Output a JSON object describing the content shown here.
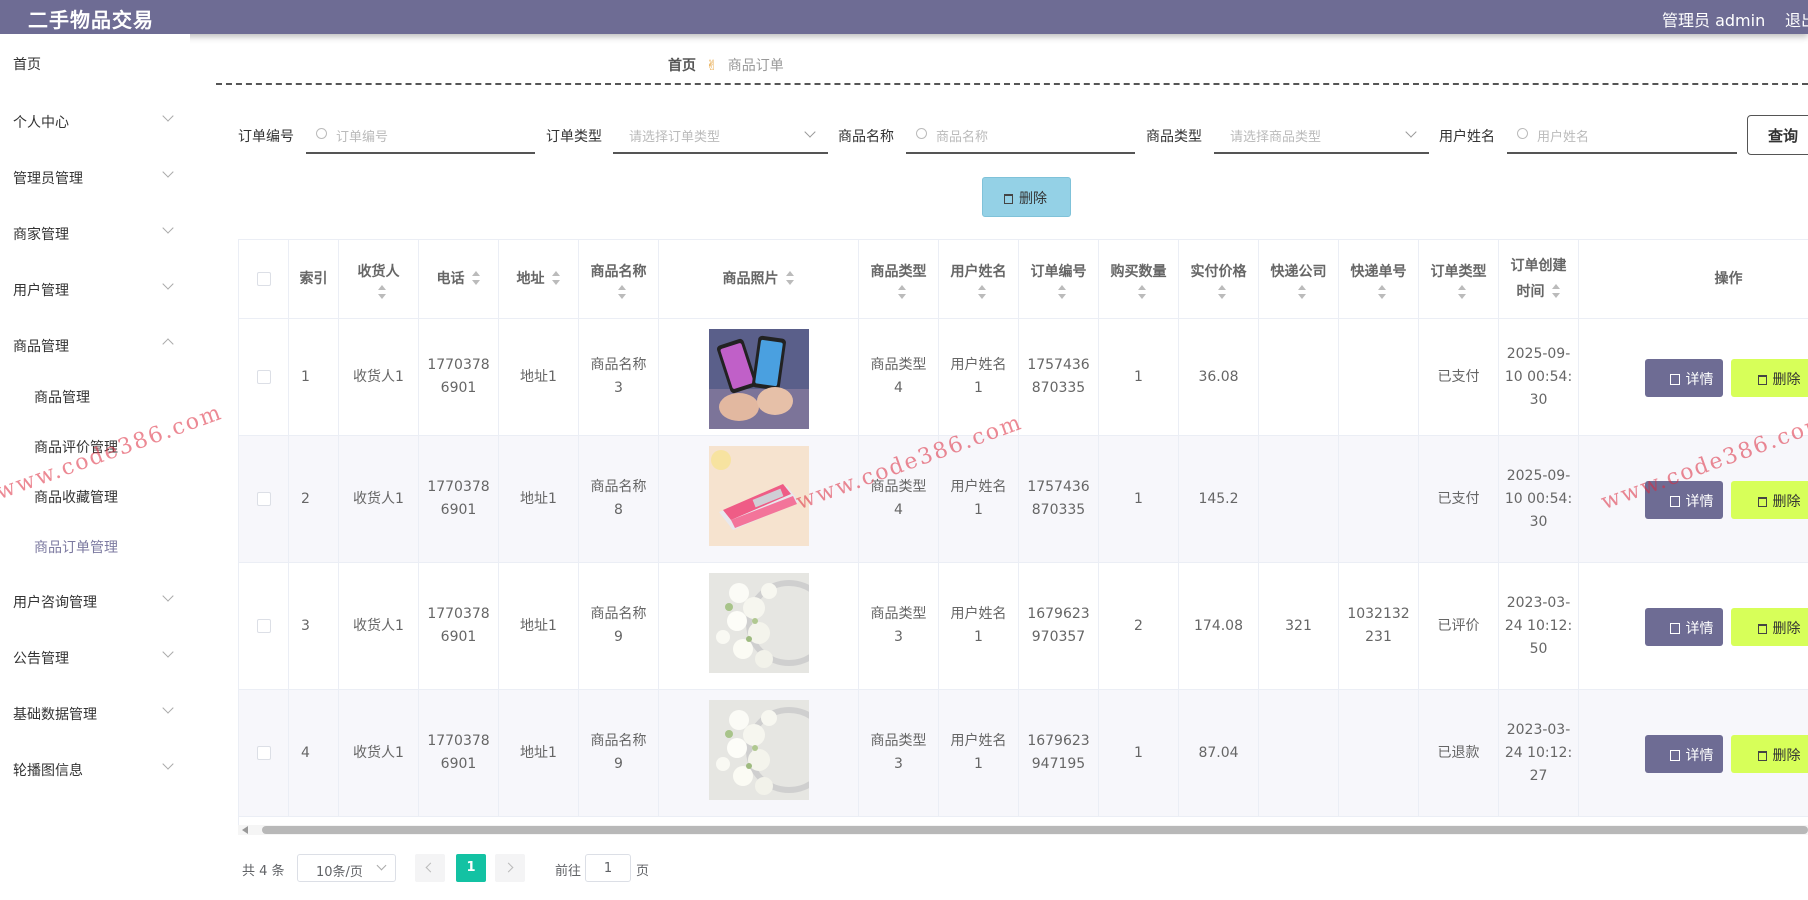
{
  "header": {
    "brand": "二手物品交易",
    "user": "管理员 admin",
    "logout": "退出"
  },
  "sidebar": {
    "items": [
      {
        "label": "首页"
      },
      {
        "label": "个人中心"
      },
      {
        "label": "管理员管理"
      },
      {
        "label": "商家管理"
      },
      {
        "label": "用户管理"
      },
      {
        "label": "商品管理"
      },
      {
        "label": "用户咨询管理"
      },
      {
        "label": "公告管理"
      },
      {
        "label": "基础数据管理"
      },
      {
        "label": "轮播图信息"
      }
    ],
    "sub_items": [
      {
        "label": "商品管理"
      },
      {
        "label": "商品评价管理"
      },
      {
        "label": "商品收藏管理"
      },
      {
        "label": "商品订单管理"
      }
    ]
  },
  "breadcrumb": {
    "home": "首页",
    "current": "商品订单"
  },
  "filters": {
    "order_no": {
      "label": "订单编号",
      "placeholder": "订单编号"
    },
    "order_type": {
      "label": "订单类型",
      "placeholder": "请选择订单类型"
    },
    "product_name": {
      "label": "商品名称",
      "placeholder": "商品名称"
    },
    "product_type": {
      "label": "商品类型",
      "placeholder": "请选择商品类型"
    },
    "user_name": {
      "label": "用户姓名",
      "placeholder": "用户姓名"
    },
    "query_label": "查询"
  },
  "toolbar": {
    "delete_label": "删除"
  },
  "table": {
    "headers": {
      "index": "索引",
      "receiver": "收货人",
      "phone": "电话",
      "address": "地址",
      "product_name": "商品名称",
      "photo": "商品照片",
      "product_type": "商品类型",
      "user_name": "用户姓名",
      "order_no": "订单编号",
      "qty": "购买数量",
      "price": "实付价格",
      "courier": "快递公司",
      "tracking": "快递单号",
      "order_type": "订单类型",
      "created": "订单创建时间",
      "actions": "操作"
    },
    "rows": [
      {
        "index": "1",
        "receiver": "收货人1",
        "phone": "17703786901",
        "address": "地址1",
        "product_name": "商品名称3",
        "photo": "phones",
        "product_type": "商品类型4",
        "user_name": "用户姓名1",
        "order_no": "1757436870335",
        "qty": "1",
        "price": "36.08",
        "courier": "",
        "tracking": "",
        "order_type": "已支付",
        "created": "2025-09-10 00:54:30"
      },
      {
        "index": "2",
        "receiver": "收货人1",
        "phone": "17703786901",
        "address": "地址1",
        "product_name": "商品名称8",
        "photo": "stapler",
        "product_type": "商品类型4",
        "user_name": "用户姓名1",
        "order_no": "1757436870335",
        "qty": "1",
        "price": "145.2",
        "courier": "",
        "tracking": "",
        "order_type": "已支付",
        "created": "2025-09-10 00:54:30"
      },
      {
        "index": "3",
        "receiver": "收货人1",
        "phone": "17703786901",
        "address": "地址1",
        "product_name": "商品名称9",
        "photo": "flowers",
        "product_type": "商品类型3",
        "user_name": "用户姓名1",
        "order_no": "1679623970357",
        "qty": "2",
        "price": "174.08",
        "courier": "321",
        "tracking": "1032132231",
        "order_type": "已评价",
        "created": "2023-03-24 10:12:50"
      },
      {
        "index": "4",
        "receiver": "收货人1",
        "phone": "17703786901",
        "address": "地址1",
        "product_name": "商品名称9",
        "photo": "flowers",
        "product_type": "商品类型3",
        "user_name": "用户姓名1",
        "order_no": "1679623947195",
        "qty": "1",
        "price": "87.04",
        "courier": "",
        "tracking": "",
        "order_type": "已退款",
        "created": "2023-03-24 10:12:27"
      }
    ],
    "detail_label": "详情",
    "delete_label": "删除"
  },
  "pagination": {
    "total": "共 4 条",
    "page_size": "10条/页",
    "current": "1",
    "goto_label": "前往",
    "goto_value": "1",
    "page_unit": "页"
  },
  "watermark": "www.code386.com",
  "colors": {
    "header": "#6e6c94",
    "detail_button": "#6e6c94",
    "delete_button": "#d7ff59",
    "toolbar_delete": "#94d1e6",
    "active_page": "#13c2a3"
  }
}
